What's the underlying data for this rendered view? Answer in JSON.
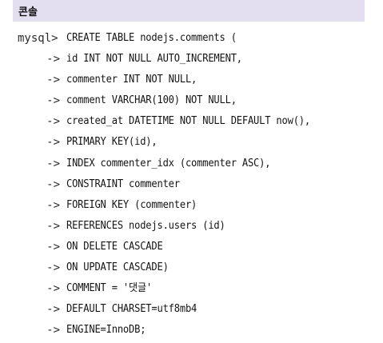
{
  "header": {
    "title": "콘솔"
  },
  "console": {
    "lines": [
      {
        "prompt": "mysql>",
        "code": "CREATE TABLE nodejs.comments ("
      },
      {
        "prompt": "->",
        "code": "id INT NOT NULL AUTO_INCREMENT,"
      },
      {
        "prompt": "->",
        "code": "commenter INT NOT NULL,"
      },
      {
        "prompt": "->",
        "code": "comment VARCHAR(100) NOT NULL,"
      },
      {
        "prompt": "->",
        "code": "created_at DATETIME NOT NULL DEFAULT now(),"
      },
      {
        "prompt": "->",
        "code": "PRIMARY KEY(id),"
      },
      {
        "prompt": "->",
        "code": "INDEX commenter_idx (commenter ASC),"
      },
      {
        "prompt": "->",
        "code": "CONSTRAINT commenter"
      },
      {
        "prompt": "->",
        "code": "FOREIGN KEY (commenter)"
      },
      {
        "prompt": "->",
        "code": "REFERENCES nodejs.users (id)"
      },
      {
        "prompt": "->",
        "code": "ON DELETE CASCADE"
      },
      {
        "prompt": "->",
        "code": "ON UPDATE CASCADE)"
      },
      {
        "prompt": "->",
        "code": "COMMENT = '댓글'"
      },
      {
        "prompt": "->",
        "code": "DEFAULT CHARSET=utf8mb4"
      },
      {
        "prompt": "->",
        "code": "ENGINE=InnoDB;"
      }
    ]
  }
}
